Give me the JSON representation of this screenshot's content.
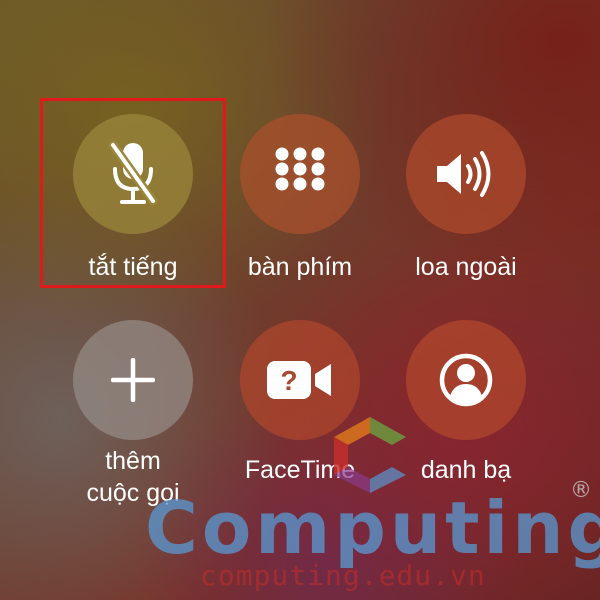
{
  "buttons": [
    {
      "label": "tắt tiếng",
      "icon": "mic-muted-icon",
      "state": "selected"
    },
    {
      "label": "bàn phím",
      "icon": "keypad-icon"
    },
    {
      "label": "loa ngoài",
      "icon": "speaker-icon"
    },
    {
      "label": "thêm cuộc gọi",
      "label_line1": "thêm",
      "label_line2": "cuộc gọi",
      "icon": "plus-icon"
    },
    {
      "label": "FaceTime",
      "icon": "facetime-unknown-icon"
    },
    {
      "label": "danh bạ",
      "icon": "contacts-icon"
    }
  ],
  "highlight": {
    "target": "tắt tiếng",
    "color": "#e01a1a"
  },
  "watermark": {
    "brand": "Computing",
    "registered": "®",
    "url": "computing.edu.vn",
    "colors": {
      "brand_text": "#5a96cd",
      "url_text": "#c82d28",
      "logo_green": "#6aa040",
      "logo_orange": "#e07a1c",
      "logo_red": "#c8302a",
      "logo_purple": "#8a3a8a"
    }
  },
  "colors": {
    "mute_button": "#8a7a3a",
    "button_warm": "#a24a30",
    "add_call_button": "#8e8680",
    "icon": "#ffffff"
  }
}
